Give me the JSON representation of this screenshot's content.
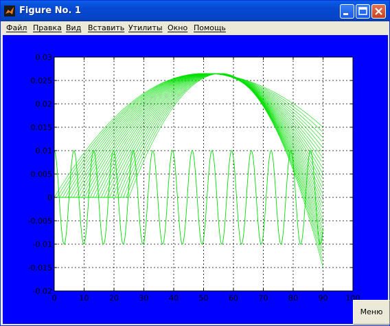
{
  "window": {
    "title": "Figure No. 1"
  },
  "menu": [
    "Файл",
    "Правка",
    "Вид",
    "Вставить",
    "Утилиты",
    "Окно",
    "Помощь"
  ],
  "menu_button": "Меню",
  "colors": {
    "figure_bg": "#0000ff",
    "axes_bg": "#ffffff",
    "line": "#00e000",
    "grid": "#000000"
  },
  "chart_data": {
    "type": "line",
    "title": "",
    "xlabel": "",
    "ylabel": "",
    "xlim": [
      0,
      100
    ],
    "ylim": [
      -0.02,
      0.03
    ],
    "xticks": [
      0,
      10,
      20,
      30,
      40,
      50,
      60,
      70,
      80,
      90,
      100
    ],
    "yticks": [
      -0.02,
      -0.015,
      -0.01,
      -0.005,
      0,
      0.005,
      0.01,
      0.015,
      0.02,
      0.025,
      0.03
    ],
    "xtick_labels": [
      "0",
      "10",
      "20",
      "30",
      "40",
      "50",
      "60",
      "70",
      "80",
      "90",
      "100"
    ],
    "ytick_labels": [
      "-0.02",
      "-0.015",
      "-0.01",
      "-0.005",
      "0",
      "0.005",
      "0.01",
      "0.015",
      "0.02",
      "0.025",
      "0.03"
    ],
    "grid": true,
    "grid_style": "dashed",
    "series": [
      {
        "kind": "oscillation",
        "x": [
          0,
          90
        ],
        "amplitude": 0.01,
        "period": 6.6,
        "phase_start": "max"
      },
      {
        "kind": "parabola_family",
        "count": 28,
        "start_x": [
          0,
          25
        ],
        "x_end": 90,
        "peak_y": 0.0265,
        "peak_x": [
          50,
          56
        ],
        "end_y": [
          0.015,
          -0.015
        ]
      }
    ],
    "legend": "none"
  }
}
